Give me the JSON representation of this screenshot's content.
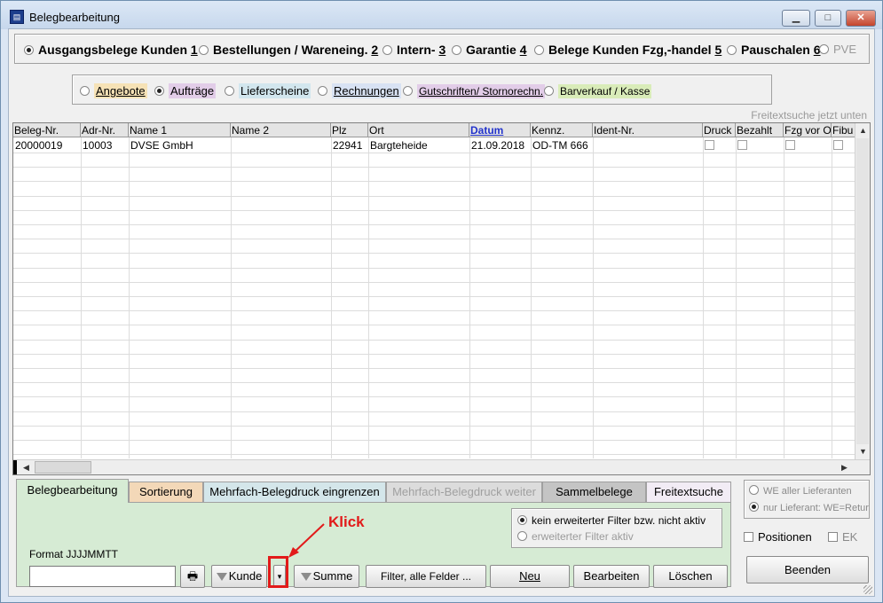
{
  "window": {
    "title": "Belegbearbeitung",
    "minimize": "▁",
    "maximize": "□",
    "close": "✕"
  },
  "mainRadios": [
    {
      "label": "Ausgangsbelege Kunden",
      "key": "1",
      "checked": true,
      "bold": true
    },
    {
      "label": "Bestellungen / Wareneing.",
      "key": "2",
      "checked": false
    },
    {
      "label": "Intern-",
      "key": "3",
      "checked": false
    },
    {
      "label": "Garantie",
      "key": "4",
      "checked": false
    },
    {
      "label": "Belege Kunden Fzg,-handel",
      "key": "5",
      "checked": false
    },
    {
      "label": "Pauschalen",
      "key": "6",
      "checked": false
    },
    {
      "label": "PVE",
      "key": "",
      "checked": false,
      "disabled": true
    }
  ],
  "subRadios": [
    {
      "label": "Angebote",
      "checked": false,
      "color": "#f6e2b6"
    },
    {
      "label": "Aufträge",
      "checked": true,
      "color": "#e2cde8"
    },
    {
      "label": "Lieferscheine",
      "checked": false,
      "color": "#d2e6ee"
    },
    {
      "label": "Rechnungen",
      "checked": false,
      "color": "#d8e2f3"
    },
    {
      "label": "Gutschriften/ Stornorechn.",
      "checked": false,
      "color": "#e2cde8"
    },
    {
      "label": "Barverkauf / Kasse",
      "checked": false,
      "color": "#d9ecb9"
    }
  ],
  "freetextHint": "Freitextsuche jetzt unten",
  "table": {
    "columns": [
      "Beleg-Nr.",
      "Adr-Nr.",
      "Name 1",
      "Name 2",
      "Plz",
      "Ort",
      "Datum",
      "Kennz.",
      "Ident-Nr.",
      "Druck",
      "Bezahlt",
      "Fzg vor O",
      "Fibu"
    ],
    "rows": [
      {
        "belegNr": "20000019",
        "adrNr": "10003",
        "name1": "DVSE GmbH",
        "name2": "",
        "plz": "22941",
        "ort": "Bargteheide",
        "datum": "21.09.2018",
        "kennz": "OD-TM 666",
        "identNr": ""
      }
    ]
  },
  "tabs": [
    {
      "label": "Belegbearbeitung",
      "active": true,
      "color": "#d6ebd4"
    },
    {
      "label": "Sortierung",
      "color": "#f3d8b8"
    },
    {
      "label": "Mehrfach-Belegdruck eingrenzen",
      "color": "#d4e6ea"
    },
    {
      "label": "Mehrfach-Belegdruck weiter",
      "color": "#dcdcdc",
      "disabled": true
    },
    {
      "label": "Sammelbelege",
      "color": "#c4c4c4"
    },
    {
      "label": "Freitextsuche",
      "color": "#f2ecf5"
    }
  ],
  "filterRadios": [
    {
      "label": "kein erweiterter Filter bzw. nicht aktiv",
      "checked": true
    },
    {
      "label": "erweiterter Filter aktiv",
      "checked": false
    }
  ],
  "formatLabel": "Format JJJJMMTT",
  "dateInput": "",
  "buttons": {
    "kunde": "Kunde",
    "summe": "Summe",
    "filterAll": "Filter, alle Felder ...",
    "neu": "Neu",
    "bearbeiten": "Bearbeiten",
    "loeschen": "Löschen",
    "beenden": "Beenden"
  },
  "rightRadios": [
    {
      "label": "WE aller Lieferanten",
      "checked": false
    },
    {
      "label": "nur Lieferant: WE=Retur",
      "checked": true
    }
  ],
  "checkboxes": {
    "positionen": "Positionen",
    "ek": "EK"
  },
  "annotation": {
    "text": "Klick",
    "color": "#e21a1a"
  }
}
